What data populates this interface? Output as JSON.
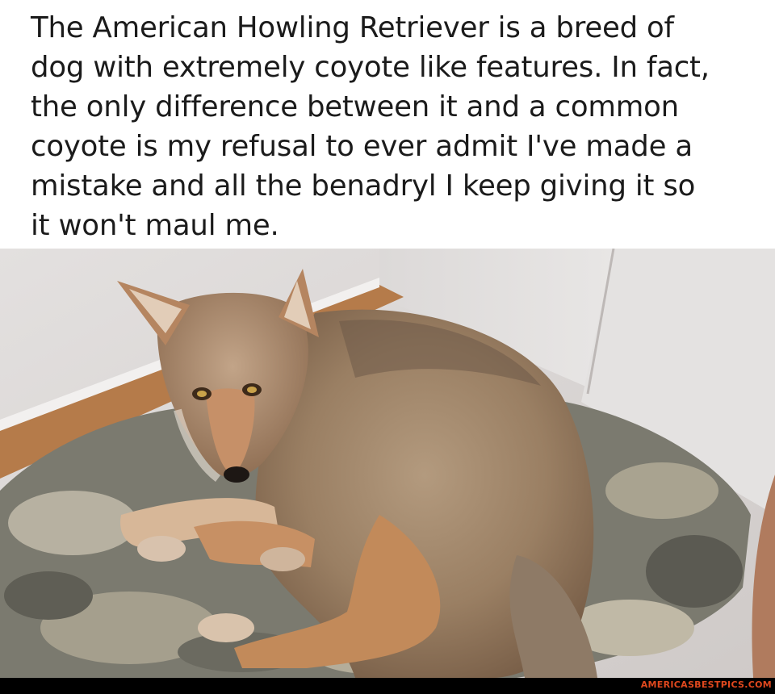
{
  "meme": {
    "caption_lines": [
      "The American Howling Retriever is a breed of",
      "dog with extremely coyote like features. In fact,",
      "the only difference between it and a common",
      "coyote is my refusal to ever admit I've made a",
      "mistake and all the benadryl I keep giving it so",
      "it won't maul me."
    ],
    "watermark": "AMERICASBESTPICS.COM"
  },
  "photo": {
    "subject": "coyote lying on a camouflage-pattern dog bed in a corner of a white room"
  }
}
